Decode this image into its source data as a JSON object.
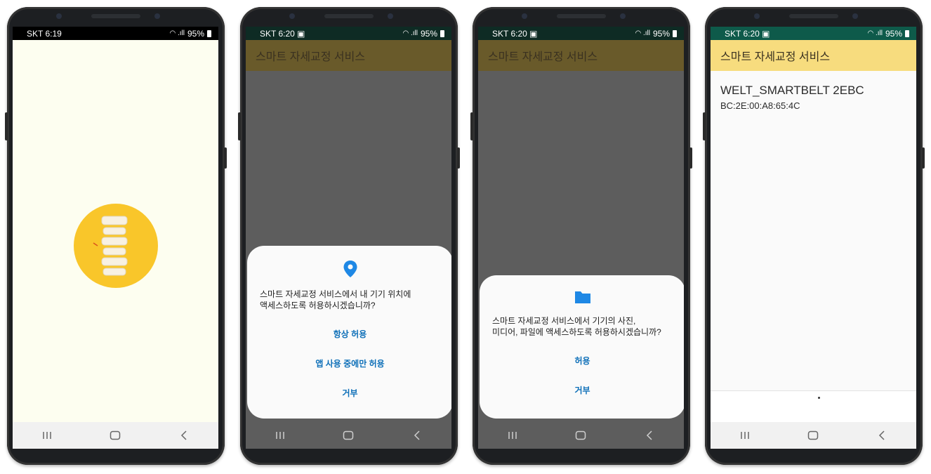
{
  "screens": [
    {
      "status": {
        "carrier_time": "SKT 6:19",
        "battery": "95%"
      },
      "logo": "spine-logo"
    },
    {
      "status": {
        "carrier_time": "SKT 6:20",
        "battery": "95%"
      },
      "app_title": "스마트 자세교정 서비스",
      "dialog": {
        "icon": "location-pin-icon",
        "message_line1": "스마트 자세교정 서비스에서 내 기기 위치에",
        "message_line2": "액세스하도록 허용하시겠습니까?",
        "buttons": [
          "항상 허용",
          "앱 사용 중에만 허용",
          "거부"
        ]
      }
    },
    {
      "status": {
        "carrier_time": "SKT 6:20",
        "battery": "95%"
      },
      "app_title": "스마트 자세교정 서비스",
      "dialog": {
        "icon": "folder-icon",
        "message_line1": "스마트 자세교정 서비스에서 기기의 사진,",
        "message_line2": "미디어, 파일에 액세스하도록 허용하시겠습니까?",
        "buttons": [
          "허용",
          "거부"
        ]
      }
    },
    {
      "status": {
        "carrier_time": "SKT 6:20",
        "battery": "95%"
      },
      "app_title": "스마트 자세교정 서비스",
      "device": {
        "name": "WELT_SMARTBELT 2EBC",
        "address": "BC:2E:00:A8:65:4C"
      }
    }
  ],
  "colors": {
    "splash_bg": "#fdfef0",
    "logo_yellow": "#f9c62a",
    "appbar_yellow": "#f7dc7e",
    "appbar_dim": "#695a2a",
    "dim_bg": "#5d5d5d",
    "dialog_blue": "#0d6fb8"
  }
}
